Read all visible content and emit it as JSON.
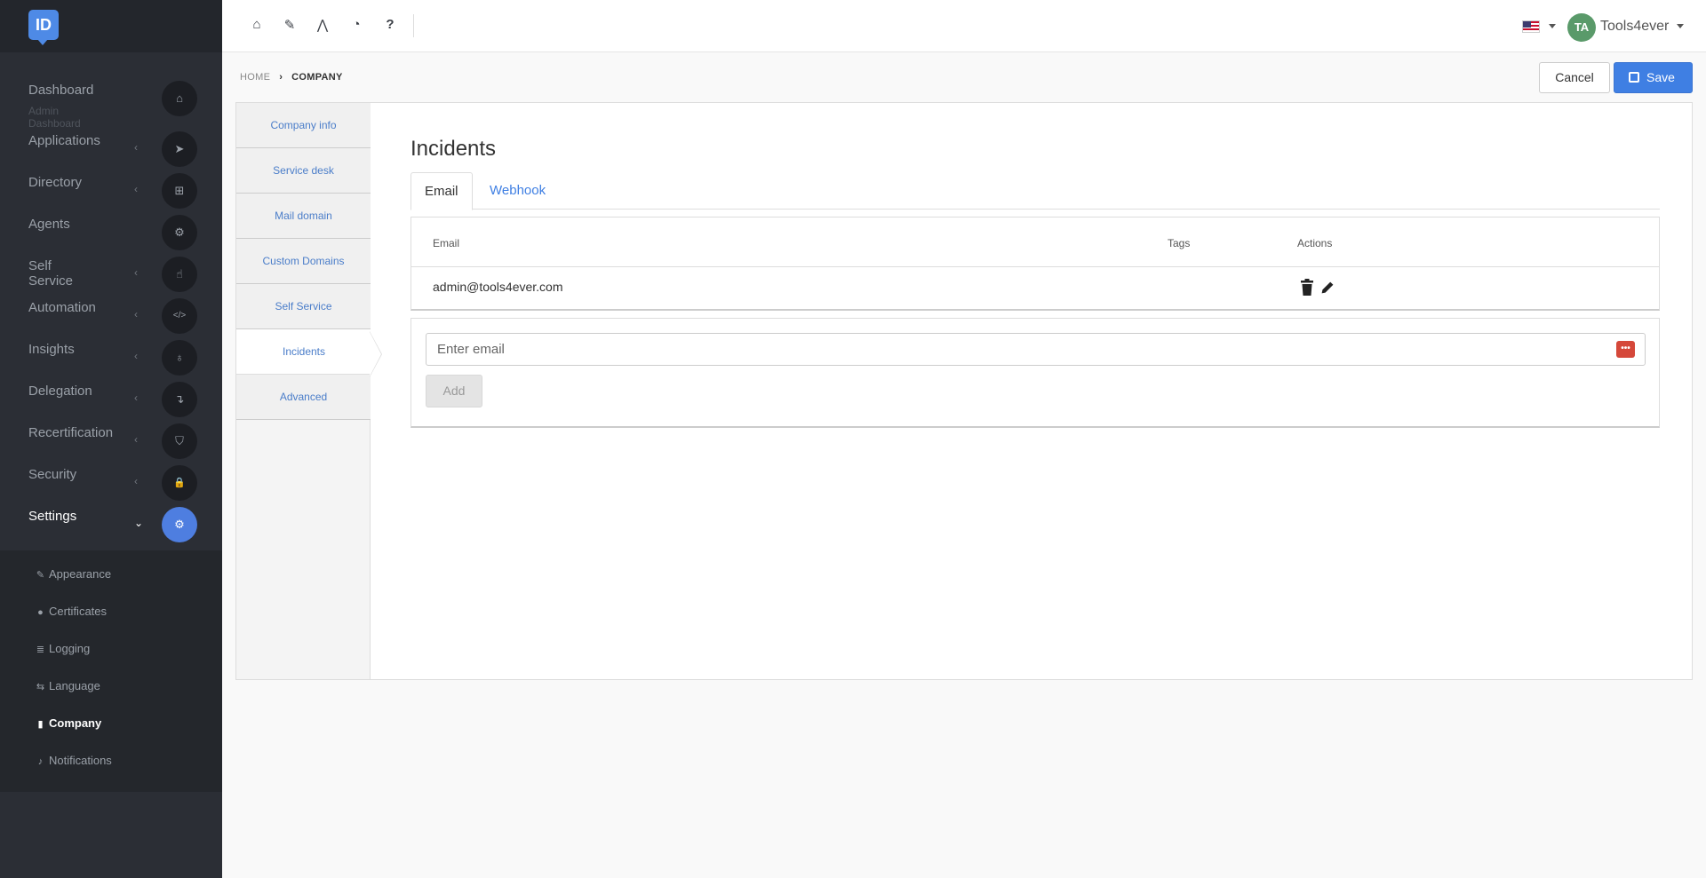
{
  "sidebar": {
    "logo": "ID",
    "nav": [
      {
        "label": "Dashboard",
        "sub": "Admin Dashboard",
        "icon": "⌂",
        "chevron": ""
      },
      {
        "label": "Applications",
        "icon": "➤",
        "chevron": "‹"
      },
      {
        "label": "Directory",
        "icon": "⊞",
        "chevron": "‹"
      },
      {
        "label": "Agents",
        "icon": "⚙",
        "chevron": ""
      },
      {
        "label": "Self Service",
        "icon": "☝",
        "chevron": "‹"
      },
      {
        "label": "Automation",
        "icon": "</>",
        "chevron": "‹"
      },
      {
        "label": "Insights",
        "icon": "♁",
        "chevron": "‹"
      },
      {
        "label": "Delegation",
        "icon": "↴",
        "chevron": "‹"
      },
      {
        "label": "Recertification",
        "icon": "⛉",
        "chevron": "‹"
      },
      {
        "label": "Security",
        "icon": "🔒",
        "chevron": "‹"
      },
      {
        "label": "Settings",
        "icon": "⚙",
        "chevron": "⌄"
      }
    ],
    "subnav": [
      {
        "label": "Appearance",
        "icon": "✎"
      },
      {
        "label": "Certificates",
        "icon": "●"
      },
      {
        "label": "Logging",
        "icon": "≣"
      },
      {
        "label": "Language",
        "icon": "⇆"
      },
      {
        "label": "Company",
        "icon": "▮"
      },
      {
        "label": "Notifications",
        "icon": "♪"
      }
    ]
  },
  "topbar": {
    "icons": [
      "⌂",
      "✎",
      "⋀",
      "◔",
      "?"
    ],
    "user_initials": "TA",
    "user_name": "Tools4ever"
  },
  "breadcrumb": {
    "home": "HOME",
    "current": "COMPANY"
  },
  "actions": {
    "cancel": "Cancel",
    "save": "Save"
  },
  "subtabs": [
    "Company info",
    "Service desk",
    "Mail domain",
    "Custom Domains",
    "Self Service",
    "Incidents",
    "Advanced"
  ],
  "main": {
    "title": "Incidents",
    "tabs": [
      "Email",
      "Webhook"
    ],
    "table": {
      "headers": [
        "Email",
        "Tags",
        "Actions"
      ],
      "rows": [
        {
          "email": "admin@tools4ever.com",
          "tags": ""
        }
      ]
    },
    "form": {
      "placeholder": "Enter email",
      "add_label": "Add"
    }
  }
}
